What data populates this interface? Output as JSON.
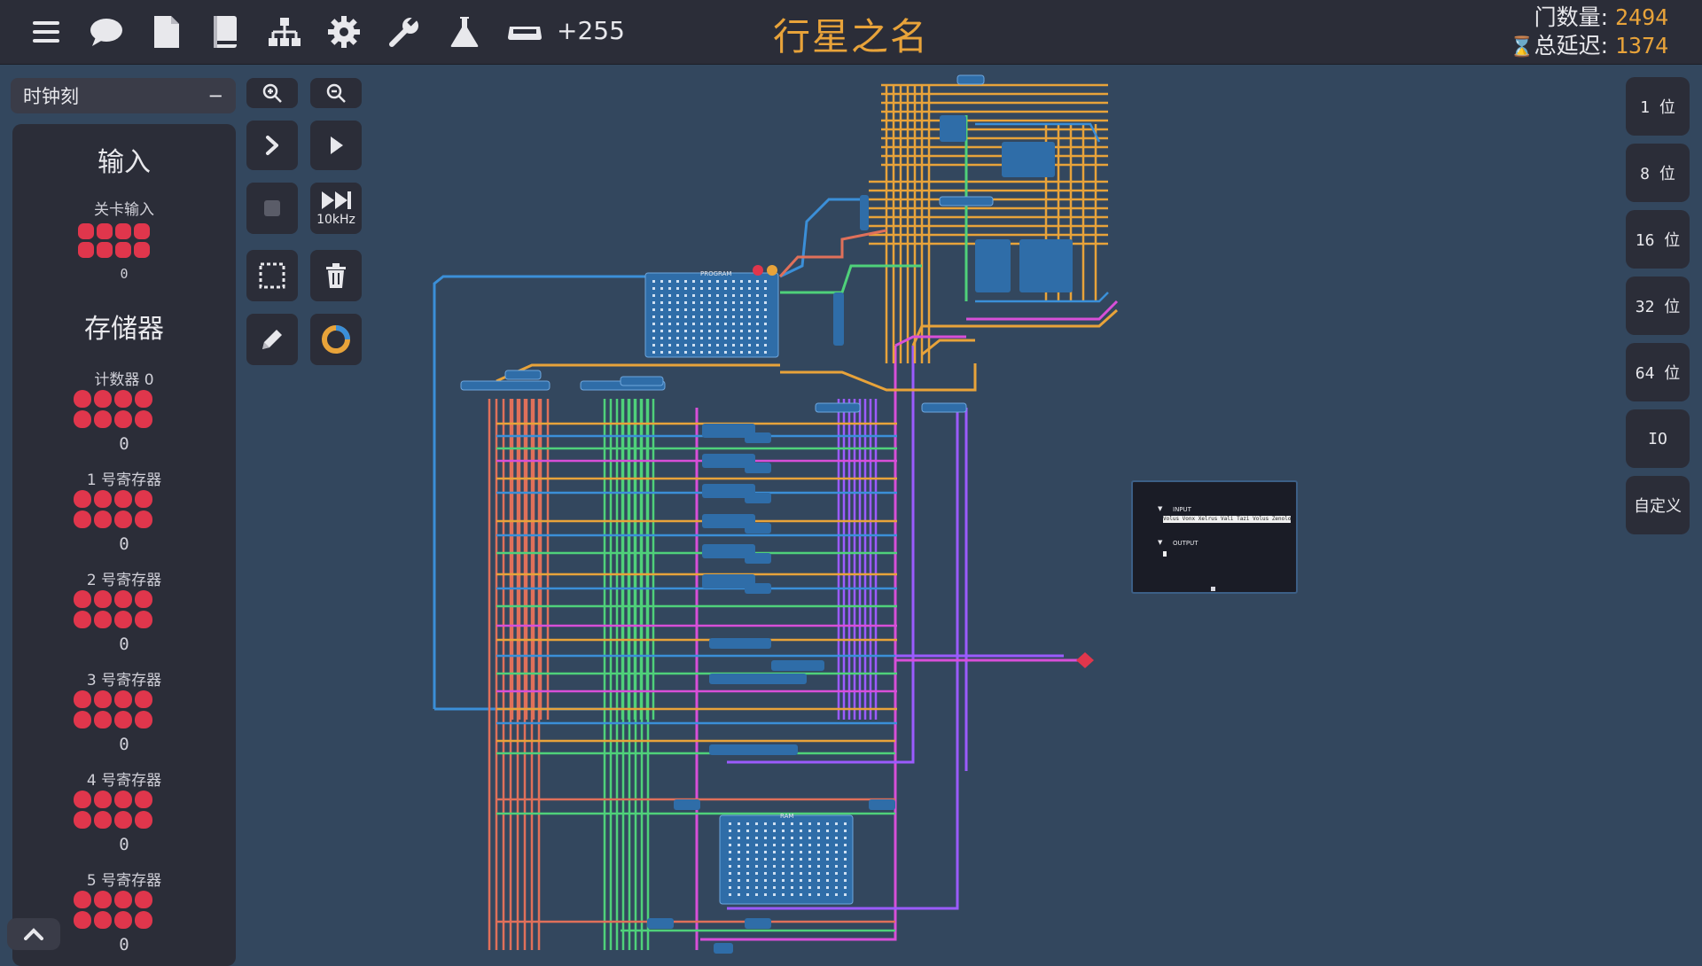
{
  "toolbar": {
    "icons": [
      "menu-icon",
      "chat-icon",
      "document-icon",
      "book-icon",
      "hierarchy-icon",
      "gear-icon",
      "wrench-icon",
      "flask-icon",
      "component-box-icon"
    ],
    "component_count": "+255"
  },
  "level": {
    "title": "行星之名"
  },
  "stats": {
    "gates_label": "门数量:",
    "gates_value": "2494",
    "delay_label": "总延迟:",
    "delay_value": "1374"
  },
  "clock": {
    "label": "时钟刻",
    "toggle": "−"
  },
  "panel": {
    "input_title": "输入",
    "input_label": "关卡输入",
    "input_value": "0",
    "storage_title": "存储器",
    "registers": [
      {
        "label": "计数器 0",
        "value": "0"
      },
      {
        "label": "1 号寄存器",
        "value": "0"
      },
      {
        "label": "2 号寄存器",
        "value": "0"
      },
      {
        "label": "3 号寄存器",
        "value": "0"
      },
      {
        "label": "4 号寄存器",
        "value": "0"
      },
      {
        "label": "5 号寄存器",
        "value": "0"
      }
    ]
  },
  "tools": {
    "speed_label": "10kHz"
  },
  "bits": [
    "1 位",
    "8 位",
    "16 位",
    "32 位",
    "64 位",
    "IO",
    "自定义"
  ],
  "io_window": {
    "input_title": "INPUT",
    "input_text": "Volus Vonx Xelrus Vali Tazi Volus Zenoloa",
    "output_title": "OUTPUT"
  },
  "circuit": {
    "program_label": "PROGRAM",
    "ram_label": "RAM",
    "colors": {
      "orange": "#e8a33a",
      "red_orange": "#e0705a",
      "green": "#4fd17a",
      "purple": "#9b5bff",
      "magenta": "#d84fd8",
      "blue": "#3b8fd8",
      "pin_red": "#e0364c"
    }
  }
}
